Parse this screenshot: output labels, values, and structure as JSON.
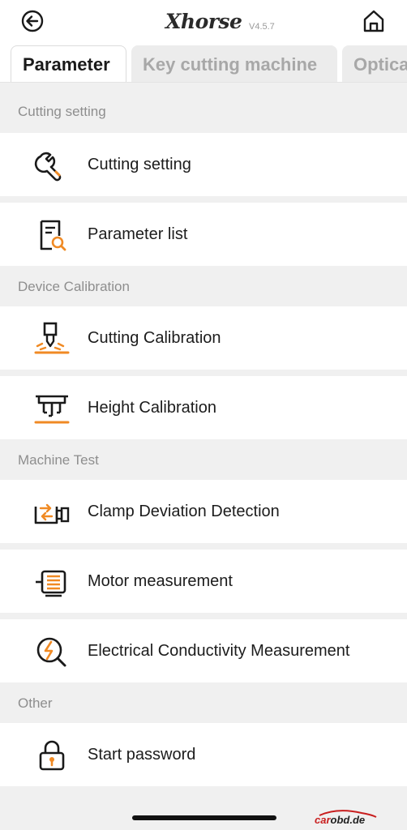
{
  "header": {
    "brand": "Xhorse",
    "version": "V4.5.7"
  },
  "tabs": [
    {
      "label": "Parameter",
      "active": true
    },
    {
      "label": "Key cutting machine",
      "active": false
    },
    {
      "label": "Optica",
      "active": false
    }
  ],
  "sections": {
    "cutting_setting": "Cutting setting",
    "device_calibration": "Device Calibration",
    "machine_test": "Machine Test",
    "other": "Other"
  },
  "items": {
    "cutting_setting": "Cutting setting",
    "parameter_list": "Parameter list",
    "cutting_calibration": "Cutting Calibration",
    "height_calibration": "Height Calibration",
    "clamp_deviation": "Clamp Deviation Detection",
    "motor_measurement": "Motor measurement",
    "electrical_conductivity": "Electrical Conductivity Measurement",
    "start_password": "Start password"
  },
  "icons": {
    "back": "back-arrow-icon",
    "home": "home-icon",
    "cutting_setting": "wrench-icon",
    "parameter_list": "document-search-icon",
    "cutting_calibration": "cutter-calibration-icon",
    "height_calibration": "height-calibration-icon",
    "clamp_deviation": "clamp-icon",
    "motor_measurement": "motor-icon",
    "electrical_conductivity": "conductivity-icon",
    "start_password": "lock-icon"
  },
  "watermark": {
    "red": "car",
    "dark": "obd.de"
  },
  "colors": {
    "accent": "#f08a24",
    "icon_dark": "#1a1a1a",
    "section_bg": "#f0f0f0",
    "section_text": "#8e8e8e",
    "watermark_red": "#c81e1e"
  }
}
